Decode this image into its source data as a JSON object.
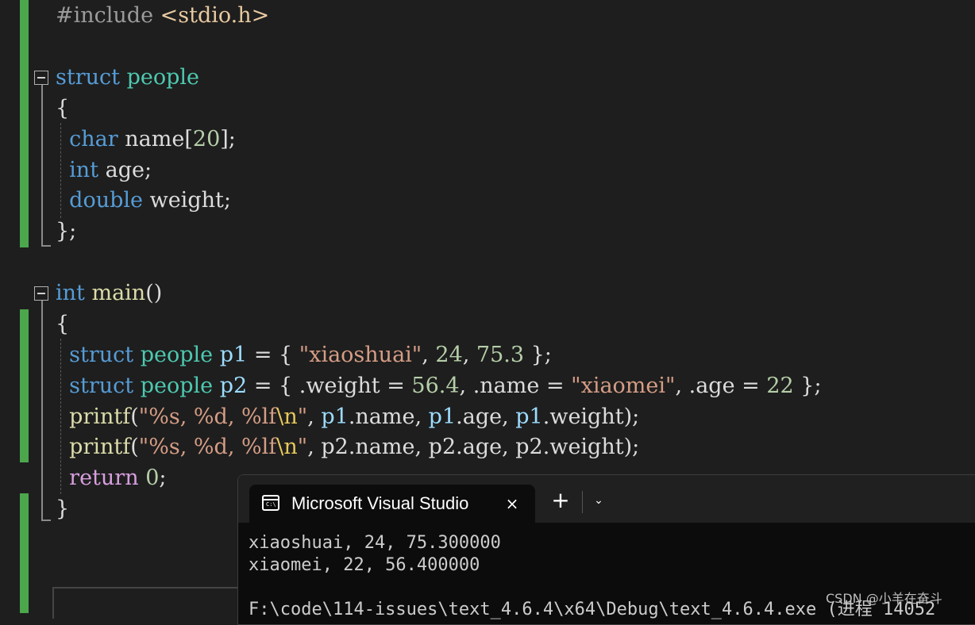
{
  "editor": {
    "include_directive": "#include",
    "include_file": "<stdio.h>",
    "kw_struct": "struct",
    "kw_char": "char",
    "kw_int": "int",
    "kw_double": "double",
    "kw_return": "return",
    "type_people": "people",
    "field_name": "name",
    "field_age": "age",
    "field_weight": "weight",
    "field_name_size": "20",
    "fn_main": "main",
    "fn_printf": "printf",
    "var_p1": "p1",
    "var_p2": "p2",
    "p1_name_value": "\"xiaoshuai\"",
    "p1_age_value": "24",
    "p1_weight_value": "75.3",
    "p2_weight_value": "56.4",
    "p2_name_value": "\"xiaomei\"",
    "p2_age_value": "22",
    "format_string_start": "\"%s, %d, %lf",
    "format_escape": "\\n",
    "format_string_end": "\"",
    "return_value": "0"
  },
  "console": {
    "tab_title": "Microsoft Visual Studio",
    "tab_close_icon": "×",
    "new_tab_icon": "+",
    "dropdown_icon": "⌄",
    "output_lines": [
      "xiaoshuai, 24, 75.300000",
      "xiaomei, 22, 56.400000",
      "",
      "F:\\code\\114-issues\\text_4.6.4\\x64\\Debug\\text_4.6.4.exe (进程 14052"
    ]
  },
  "watermark": "CSDN @小羊在奋斗",
  "colors": {
    "keyword": "#569cd6",
    "type": "#4ec9b0",
    "function": "#dcdcaa",
    "variable": "#9cdcfe",
    "number": "#b5cea8",
    "string": "#d69d85",
    "escape": "#e8c95c",
    "return": "#d8a0df",
    "change_bar": "#4ca64c"
  }
}
